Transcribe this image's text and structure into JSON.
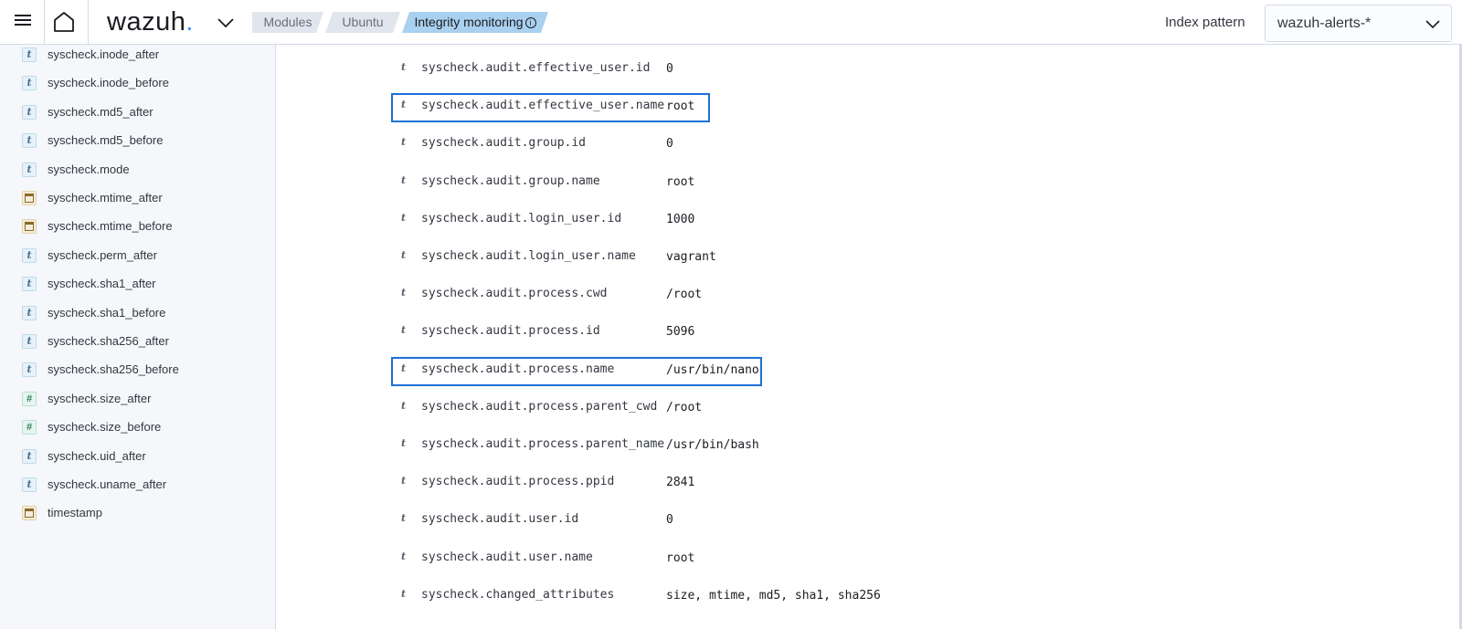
{
  "header": {
    "logo_text": "wazuh",
    "logo_dot": ".",
    "breadcrumbs": [
      {
        "label": "Modules"
      },
      {
        "label": "Ubuntu"
      },
      {
        "label": "Integrity monitoring",
        "info_icon": "i"
      }
    ],
    "index_pattern_label": "Index pattern",
    "index_pattern_value": "wazuh-alerts-*",
    "accent_color": "#3595f9"
  },
  "sidebar": {
    "fields": [
      {
        "type": "string",
        "type_glyph": "t",
        "name": "syscheck.inode_after"
      },
      {
        "type": "string",
        "type_glyph": "t",
        "name": "syscheck.inode_before"
      },
      {
        "type": "string",
        "type_glyph": "t",
        "name": "syscheck.md5_after"
      },
      {
        "type": "string",
        "type_glyph": "t",
        "name": "syscheck.md5_before"
      },
      {
        "type": "string",
        "type_glyph": "t",
        "name": "syscheck.mode"
      },
      {
        "type": "date",
        "type_glyph": "",
        "name": "syscheck.mtime_after"
      },
      {
        "type": "date",
        "type_glyph": "",
        "name": "syscheck.mtime_before"
      },
      {
        "type": "string",
        "type_glyph": "t",
        "name": "syscheck.perm_after"
      },
      {
        "type": "string",
        "type_glyph": "t",
        "name": "syscheck.sha1_after"
      },
      {
        "type": "string",
        "type_glyph": "t",
        "name": "syscheck.sha1_before"
      },
      {
        "type": "string",
        "type_glyph": "t",
        "name": "syscheck.sha256_after"
      },
      {
        "type": "string",
        "type_glyph": "t",
        "name": "syscheck.sha256_before"
      },
      {
        "type": "number",
        "type_glyph": "#",
        "name": "syscheck.size_after"
      },
      {
        "type": "number",
        "type_glyph": "#",
        "name": "syscheck.size_before"
      },
      {
        "type": "string",
        "type_glyph": "t",
        "name": "syscheck.uid_after"
      },
      {
        "type": "string",
        "type_glyph": "t",
        "name": "syscheck.uname_after"
      },
      {
        "type": "date",
        "type_glyph": "",
        "name": "timestamp"
      }
    ]
  },
  "document": {
    "highlight_color": "#1f70d6",
    "rows": [
      {
        "type_glyph": "t",
        "key": "syscheck.audit.effective_user.id",
        "value": "0",
        "highlighted": false
      },
      {
        "type_glyph": "t",
        "key": "syscheck.audit.effective_user.name",
        "value": "root",
        "highlighted": true
      },
      {
        "type_glyph": "t",
        "key": "syscheck.audit.group.id",
        "value": "0",
        "highlighted": false
      },
      {
        "type_glyph": "t",
        "key": "syscheck.audit.group.name",
        "value": "root",
        "highlighted": false
      },
      {
        "type_glyph": "t",
        "key": "syscheck.audit.login_user.id",
        "value": "1000",
        "highlighted": false
      },
      {
        "type_glyph": "t",
        "key": "syscheck.audit.login_user.name",
        "value": "vagrant",
        "highlighted": false
      },
      {
        "type_glyph": "t",
        "key": "syscheck.audit.process.cwd",
        "value": "/root",
        "highlighted": false
      },
      {
        "type_glyph": "t",
        "key": "syscheck.audit.process.id",
        "value": "5096",
        "highlighted": false
      },
      {
        "type_glyph": "t",
        "key": "syscheck.audit.process.name",
        "value": "/usr/bin/nano",
        "highlighted": true
      },
      {
        "type_glyph": "t",
        "key": "syscheck.audit.process.parent_cwd",
        "value": "/root",
        "highlighted": false
      },
      {
        "type_glyph": "t",
        "key": "syscheck.audit.process.parent_name",
        "value": "/usr/bin/bash",
        "highlighted": false
      },
      {
        "type_glyph": "t",
        "key": "syscheck.audit.process.ppid",
        "value": "2841",
        "highlighted": false
      },
      {
        "type_glyph": "t",
        "key": "syscheck.audit.user.id",
        "value": "0",
        "highlighted": false
      },
      {
        "type_glyph": "t",
        "key": "syscheck.audit.user.name",
        "value": "root",
        "highlighted": false
      },
      {
        "type_glyph": "t",
        "key": "syscheck.changed_attributes",
        "value": "size, mtime, md5, sha1, sha256",
        "highlighted": false
      }
    ]
  }
}
